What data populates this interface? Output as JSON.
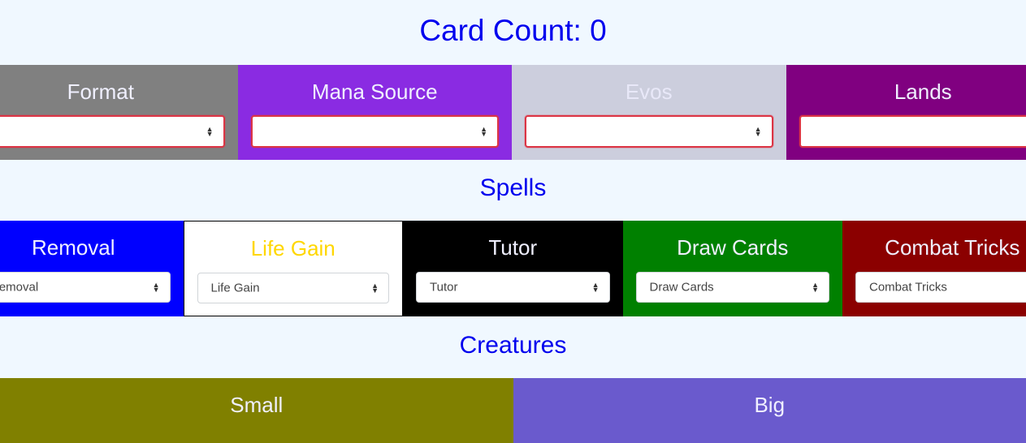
{
  "header": {
    "title": "Card Count: 0"
  },
  "top_row": [
    {
      "label": "Format",
      "bg": "#808080",
      "label_color": "#f0f0ff",
      "select_value": "",
      "invalid": true,
      "show_arrows": true
    },
    {
      "label": "Mana Source",
      "bg": "#8a2be2",
      "label_color": "#f0f0ff",
      "select_value": "",
      "invalid": true,
      "show_arrows": true
    },
    {
      "label": "Evos",
      "bg": "#cccedd",
      "label_color": "#e8e8f8",
      "select_value": "",
      "invalid": true,
      "show_arrows": true
    },
    {
      "label": "Lands",
      "bg": "#800080",
      "label_color": "#f0f0ff",
      "select_value": "",
      "invalid": true,
      "show_arrows": false
    }
  ],
  "spells": {
    "heading": "Spells",
    "items": [
      {
        "label": "Removal",
        "bg": "#0000ff",
        "label_color": "#f0f0ff",
        "select_value": "Removal"
      },
      {
        "label": "Life Gain",
        "bg": "#ffffff",
        "label_color": "#ffd700",
        "select_value": "Life Gain"
      },
      {
        "label": "Tutor",
        "bg": "#000000",
        "label_color": "#f0f0ff",
        "select_value": "Tutor"
      },
      {
        "label": "Draw Cards",
        "bg": "#008000",
        "label_color": "#f0f0ff",
        "select_value": "Draw Cards"
      },
      {
        "label": "Combat Tricks",
        "bg": "#8b0000",
        "label_color": "#f0f0ff",
        "select_value": "Combat Tricks"
      }
    ]
  },
  "creatures": {
    "heading": "Creatures",
    "items": [
      {
        "label": "Small",
        "bg": "#808000"
      },
      {
        "label": "Big",
        "bg": "#6a5acd"
      }
    ]
  },
  "icons": {
    "select_arrows": "sort-arrows-icon"
  }
}
